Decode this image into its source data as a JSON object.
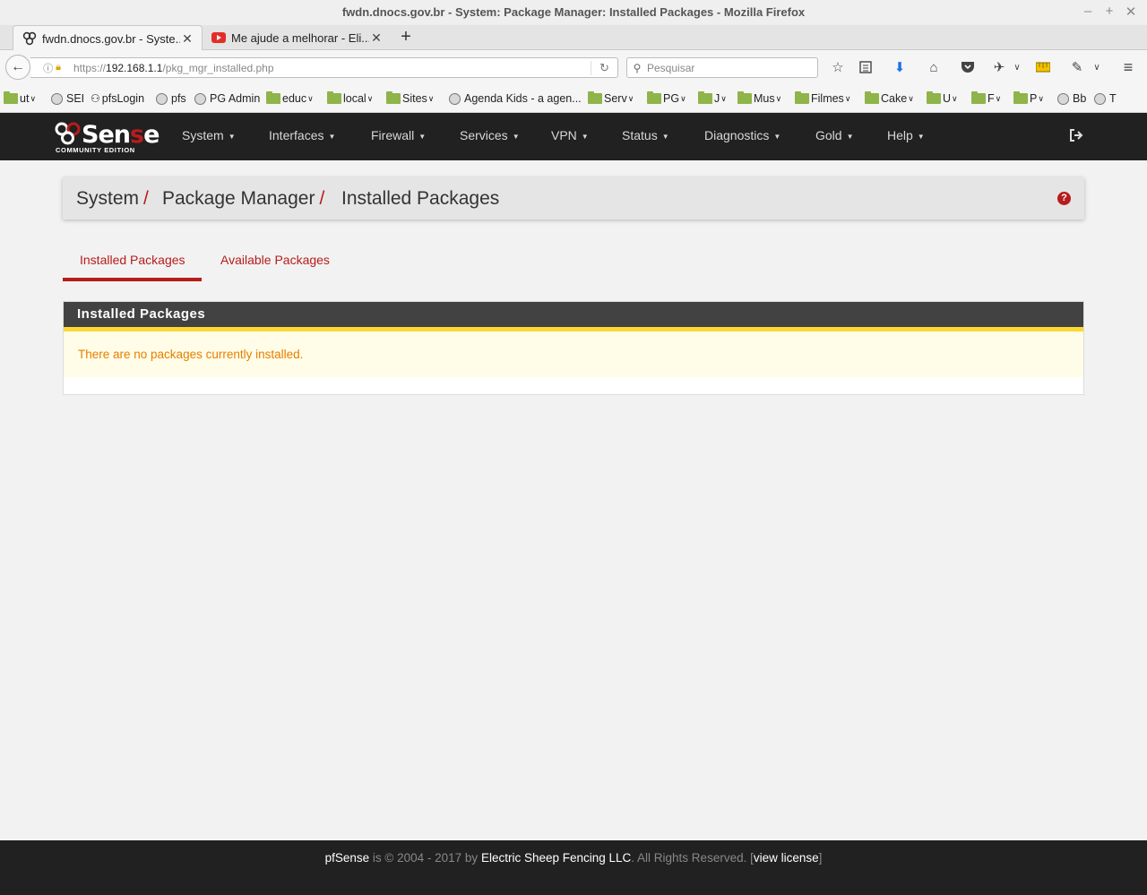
{
  "window": {
    "title": "fwdn.dnocs.gov.br - System: Package Manager: Installed Packages - Mozilla Firefox",
    "controls": [
      "–",
      "+",
      "✕"
    ]
  },
  "tabs": [
    {
      "label": "fwdn.dnocs.gov.br - Syste...",
      "icon": "pfsense-favicon",
      "active": true
    },
    {
      "label": "Me ajude a melhorar - Eli...",
      "icon": "youtube-favicon",
      "active": false
    }
  ],
  "newtab": "+",
  "url": {
    "scheme": "https://",
    "host": "192.168.1.1",
    "path": "/pkg_mgr_installed.php"
  },
  "search": {
    "placeholder": "Pesquisar"
  },
  "bookmarks": [
    {
      "label": "ut",
      "type": "folder",
      "dropdown": true
    },
    {
      "label": "SEI",
      "type": "globe"
    },
    {
      "label": "pfsLogin",
      "type": "pfsense"
    },
    {
      "label": "pfs",
      "type": "globe"
    },
    {
      "label": "PG Admin",
      "type": "globe"
    },
    {
      "label": "educ",
      "type": "folder",
      "dropdown": true
    },
    {
      "label": "local",
      "type": "folder",
      "dropdown": true
    },
    {
      "label": "Sites",
      "type": "folder",
      "dropdown": true
    },
    {
      "label": "Agenda Kids - a agen...",
      "type": "globe"
    },
    {
      "label": "Serv",
      "type": "folder",
      "dropdown": true
    },
    {
      "label": "PG",
      "type": "folder",
      "dropdown": true
    },
    {
      "label": "J",
      "type": "folder",
      "dropdown": true
    },
    {
      "label": "Mus",
      "type": "folder",
      "dropdown": true
    },
    {
      "label": "Filmes",
      "type": "folder",
      "dropdown": true
    },
    {
      "label": "Cake",
      "type": "folder",
      "dropdown": true
    },
    {
      "label": "U",
      "type": "folder",
      "dropdown": true
    },
    {
      "label": "F",
      "type": "folder",
      "dropdown": true
    },
    {
      "label": "P",
      "type": "folder",
      "dropdown": true
    },
    {
      "label": "Bb",
      "type": "globe"
    },
    {
      "label": "T",
      "type": "globe"
    }
  ],
  "pfsense": {
    "logo": {
      "brand_a": "Sen",
      "brand_b": "s",
      "brand_c": "e",
      "edition": "COMMUNITY EDITION"
    },
    "menu": [
      "System",
      "Interfaces",
      "Firewall",
      "Services",
      "VPN",
      "Status",
      "Diagnostics",
      "Gold",
      "Help"
    ],
    "breadcrumb": [
      "System",
      "Package Manager",
      "Installed Packages"
    ],
    "breadcrumb_sep": "/",
    "help_icon": "?",
    "page_tabs": [
      "Installed Packages",
      "Available Packages"
    ],
    "panel": {
      "title": "Installed Packages",
      "message": "There are no packages currently installed."
    }
  },
  "footer": {
    "product": "pfSense",
    "copyright": " is © 2004 - 2017 by ",
    "company": "Electric Sheep Fencing LLC",
    "rights": ". All Rights Reserved. [",
    "license": "view license",
    "close": "]"
  },
  "colors": {
    "accent_red": "#b71c1c",
    "navbar": "#212121",
    "panel_head": "#424242",
    "alert_bg": "#fffde7",
    "alert_border": "#fdd835",
    "alert_text": "#e67e00"
  }
}
